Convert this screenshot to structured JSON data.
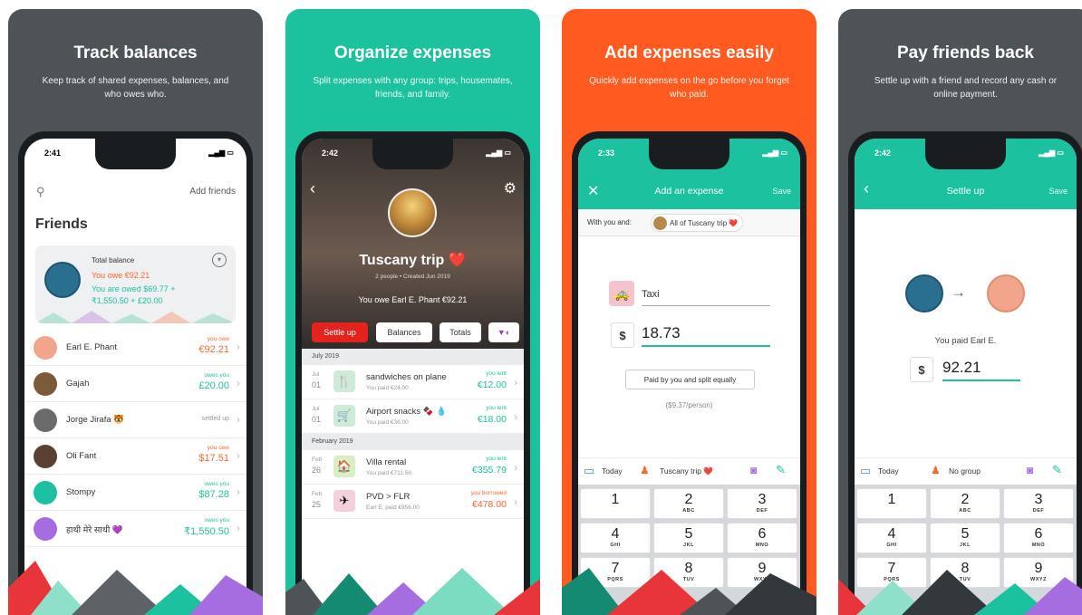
{
  "panels": [
    {
      "title": "Track balances",
      "subtitle": "Keep track of shared expenses, balances, and who owes who."
    },
    {
      "title": "Organize expenses",
      "subtitle": "Split expenses with any group: trips, housemates, friends, and family."
    },
    {
      "title": "Add expenses easily",
      "subtitle": "Quickly add expenses on the go before you forget who paid."
    },
    {
      "title": "Pay friends back",
      "subtitle": "Settle up with a friend and record any cash or online payment."
    }
  ],
  "screen1": {
    "time": "2:41",
    "add_friends": "Add friends",
    "heading": "Friends",
    "total_balance": "Total balance",
    "you_owe": "You owe €92.21",
    "you_are_owed": "You are owed $69.77 +",
    "you_are_owed2": "₹1,550.50 + £20.00",
    "friends": [
      {
        "name": "Earl E. Phant",
        "status": "you owe",
        "amount": "€92.21",
        "color": "#ff652f"
      },
      {
        "name": "Gajah",
        "status": "owes you",
        "amount": "£20.00",
        "color": "#1cc29f"
      },
      {
        "name": "Jorge Jirafa 🐯",
        "status": "settled up",
        "amount": "",
        "color": "#999999"
      },
      {
        "name": "Oli Fant",
        "status": "you owe",
        "amount": "$17.51",
        "color": "#ff652f"
      },
      {
        "name": "Stompy",
        "status": "owes you",
        "amount": "$87.28",
        "color": "#1cc29f"
      },
      {
        "name": "हाथी मेरे साथी 💜",
        "status": "owes you",
        "amount": "₹1,550.50",
        "color": "#1cc29f"
      }
    ]
  },
  "screen2": {
    "time": "2:42",
    "group_name": "Tuscany trip ❤️",
    "meta": "2 people  •  Created Jun 2019",
    "you_owe": "You owe Earl E. Phant €92.21",
    "buttons": [
      "Settle up",
      "Balances",
      "Totals"
    ],
    "sections": [
      {
        "label": "July 2019",
        "items": [
          {
            "mo": "Jul",
            "day": "01",
            "name": "sandwiches on plane",
            "paid": "You paid €24.00",
            "status": "you lent",
            "amount": "€12.00",
            "icon": "🍴"
          },
          {
            "mo": "Jul",
            "day": "01",
            "name": "Airport snacks 🍫 💧",
            "paid": "You paid €36.00",
            "status": "you lent",
            "amount": "€18.00",
            "icon": "🛒"
          }
        ]
      },
      {
        "label": "February 2019",
        "items": [
          {
            "mo": "Feb",
            "day": "26",
            "name": "Villa rental",
            "paid": "You paid €711.58",
            "status": "you lent",
            "amount": "€355.79",
            "icon": "🏠"
          },
          {
            "mo": "Feb",
            "day": "25",
            "name": "PVD > FLR",
            "paid": "Earl E. paid €956.00",
            "status": "you borrowed",
            "amount": "€478.00",
            "icon": "✈"
          }
        ]
      }
    ]
  },
  "screen3": {
    "time": "2:33",
    "title": "Add an expense",
    "save": "Save",
    "with_you": "With you and:",
    "group_chip": "All of Tuscany trip ❤️",
    "description": "Taxi",
    "currency": "$",
    "amount": "18.73",
    "split": "Paid by you and split equally",
    "per_person": "($9.37/person)",
    "date": "Today",
    "group": "Tuscany trip ❤️"
  },
  "screen4": {
    "time": "2:42",
    "title": "Settle up",
    "save": "Save",
    "paid_text": "You paid Earl E.",
    "currency": "$",
    "amount": "92.21",
    "date": "Today",
    "group": "No group"
  },
  "keypad": [
    {
      "num": "1",
      "letters": ""
    },
    {
      "num": "2",
      "letters": "ABC"
    },
    {
      "num": "3",
      "letters": "DEF"
    },
    {
      "num": "4",
      "letters": "GHI"
    },
    {
      "num": "5",
      "letters": "JKL"
    },
    {
      "num": "6",
      "letters": "MNO"
    },
    {
      "num": "7",
      "letters": "PQRS"
    },
    {
      "num": "8",
      "letters": "TUV"
    },
    {
      "num": "9",
      "letters": "WXYZ"
    }
  ],
  "colors": {
    "teal": "#1cc29f",
    "orange": "#ff652f",
    "dark": "#4d5357",
    "orange_panel": "#ff5a1f"
  }
}
